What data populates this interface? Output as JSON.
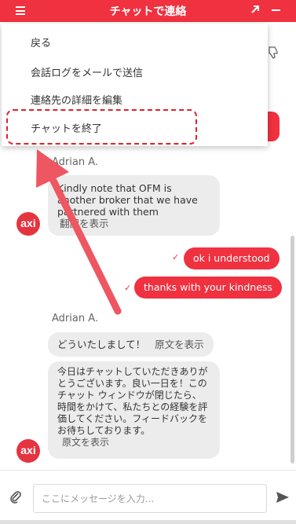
{
  "header": {
    "title": "チャットで連絡",
    "menu_icon": "hamburger-icon",
    "expand_icon": "arrow-up-right-icon",
    "minimize_icon": "minus-icon"
  },
  "menu": {
    "items": [
      "戻る",
      "会話ログをメールで送信",
      "連絡先の詳細を編集",
      "チャットを終了"
    ]
  },
  "messages": [
    {
      "sender": "Adrian A.",
      "text": "Kindly note that OFM is another broker that we have partnered with them",
      "translate": "翻訳を表示"
    },
    {
      "out": "ok i understood"
    },
    {
      "out": "thanks with your kindness"
    },
    {
      "sender": "Adrian A.",
      "text": "どういたしまして！",
      "translate": "原文を表示"
    },
    {
      "text": "今日はチャットしていただきありがとうございます。良い一日を！このチャット ウィンドウが閉じたら、時間をかけて、私たちとの経験を評価してください。フィードバックをお待ちしております。",
      "translate": "原文を表示"
    }
  ],
  "avatar_label": "axi",
  "input": {
    "placeholder": "ここにメッセージを入力..."
  },
  "colors": {
    "brand": "#f0313f",
    "bubble_in": "#ececec",
    "annotation": "#e0202e"
  }
}
